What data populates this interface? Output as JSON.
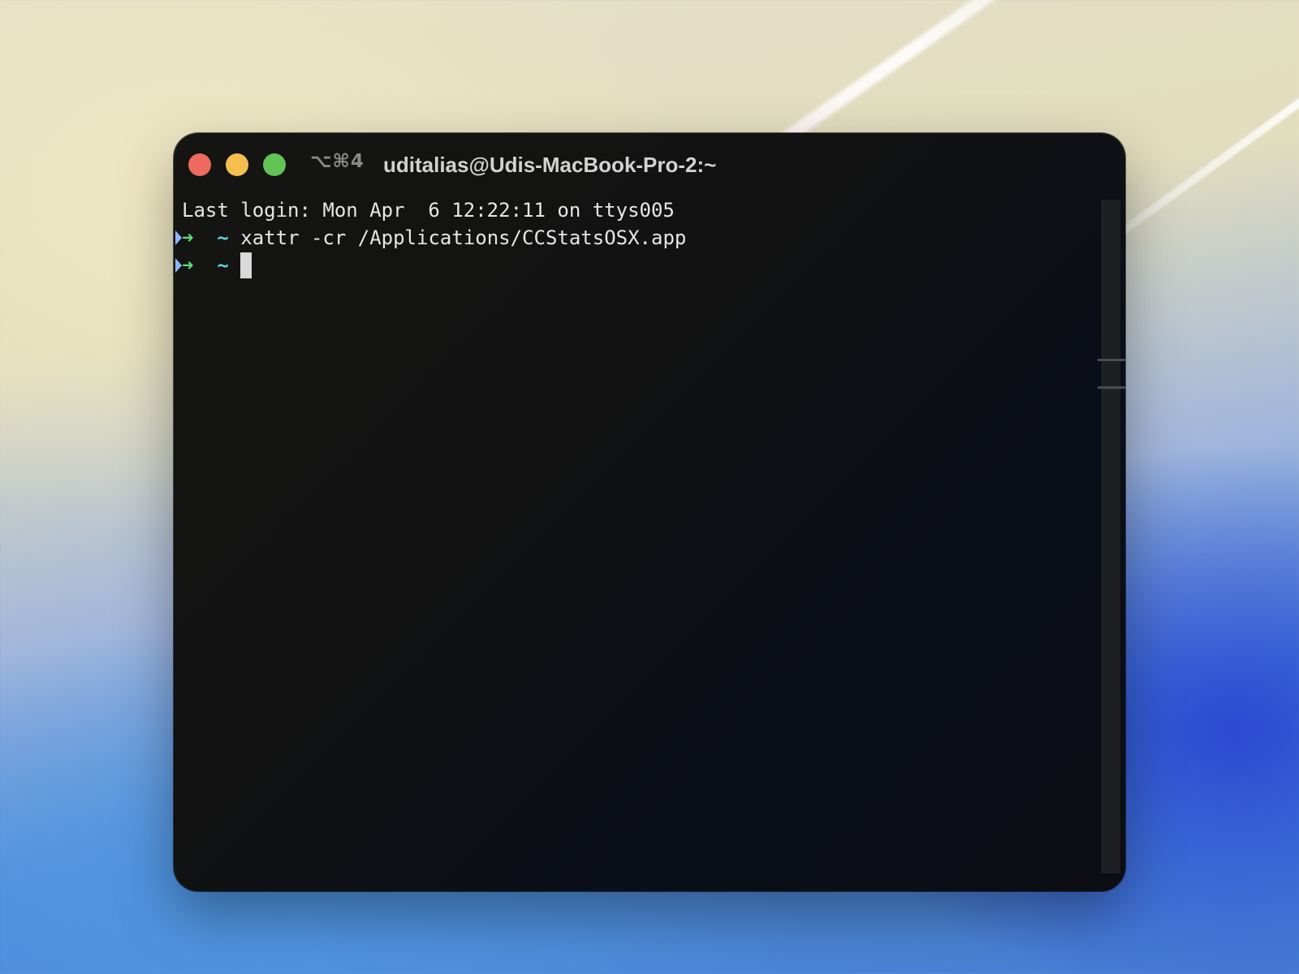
{
  "window": {
    "shortcut": "⌥⌘4",
    "title": "uditalias@Udis-MacBook-Pro-2:~"
  },
  "terminal": {
    "last_login": "Last login: Mon Apr  6 12:22:11 on ttys005",
    "prompt_arrow": "➜",
    "prompt_dir": "~",
    "command_1": "xattr -cr /Applications/CCStatsOSX.app"
  },
  "colors": {
    "close": "#ec6a5e",
    "minimize": "#f4bf4f",
    "zoom": "#61c454",
    "prompt_arrow": "#5fe07a",
    "prompt_dir": "#5fd3e0"
  }
}
